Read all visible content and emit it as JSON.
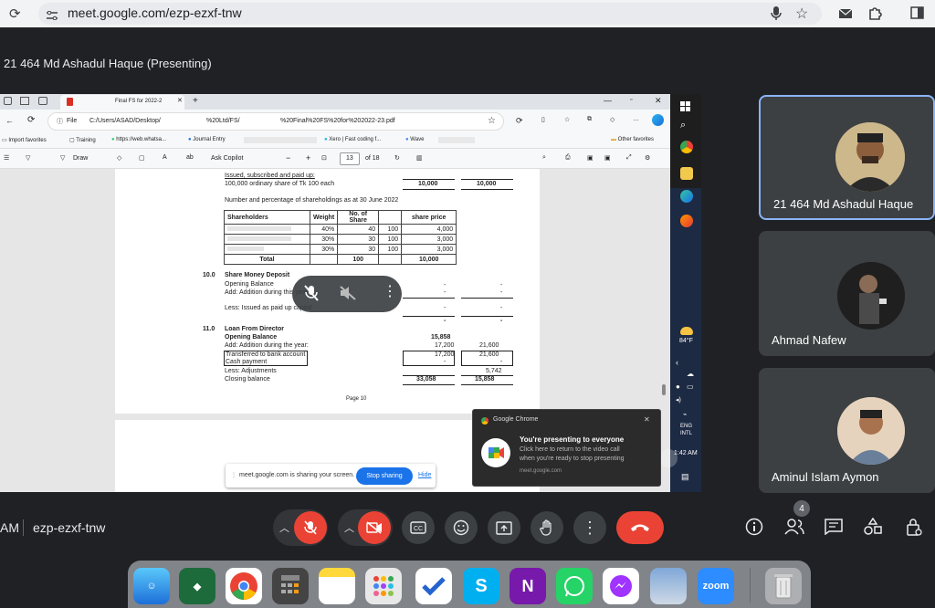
{
  "browser": {
    "url": "meet.google.com/ezp-ezxf-tnw"
  },
  "meet": {
    "presenter_title": "21 464 Md Ashadul Haque (Presenting)",
    "time_fragment": "AM",
    "meeting_code": "ezp-ezxf-tnw",
    "people_count": "4",
    "participants": [
      {
        "name": "21 464 Md Ashadul Haque"
      },
      {
        "name": "Ahmad Nafew"
      },
      {
        "name": "Aminul Islam Aymon"
      }
    ]
  },
  "shared_screen": {
    "edge_tab_title": "Final FS for 2022-2",
    "file_label": "File",
    "file_path_a": "C:/Users/ASAD/Desktop/",
    "file_path_b": "%20Ltd/FS/",
    "file_path_c": "%20Final%20FS%20for%202022-23.pdf",
    "favorites": [
      "Import favorites",
      "Training",
      "https://web.whatsa...",
      "Journal Entry",
      "Xero | Fast coding f...",
      "Wave",
      "Other favorites"
    ],
    "pdf_toolbar": {
      "draw": "Draw",
      "ask_copilot": "Ask Copilot",
      "zoom_minus": "−",
      "zoom_plus": "+",
      "page_current": "13",
      "page_total": "of 18"
    },
    "pdf": {
      "issued_heading": "Issued, subscribed and paid up:",
      "issued_line": "100,000 ordinary share of Tk 100 each",
      "issued_v1": "10,000",
      "issued_v2": "10,000",
      "shareholding_heading": "Number and percentage of shareholdings as at 30 June 2022",
      "table_headers": [
        "Shareholders",
        "Weight",
        "No. of Share",
        "",
        "share price"
      ],
      "table_rows": [
        [
          "",
          "40%",
          "40",
          "100",
          "4,000"
        ],
        [
          "",
          "30%",
          "30",
          "100",
          "3,000"
        ],
        [
          "",
          "30%",
          "30",
          "100",
          "3,000"
        ]
      ],
      "table_total": [
        "Total",
        "",
        "100",
        "",
        "10,000"
      ],
      "s10_num": "10.0",
      "s10_title": "Share Money Deposit",
      "s10_l1": "Opening Balance",
      "s10_l2": "Add:  Addition during this year",
      "s10_l3": "Less: Issued as paid up capital",
      "dash": "-",
      "s11_num": "11.0",
      "s11_title": "Loan From Director",
      "s11_opening": "Opening Balance",
      "s11_opening_v": "15,858",
      "s11_add": "Add: Addition during the year:",
      "s11_add_v1": "17,200",
      "s11_add_v2": "21,600",
      "s11_bank": "Transferred to bank account",
      "s11_bank_v1": "17,200",
      "s11_bank_v2": "21,600",
      "s11_cash": "Cash payment",
      "s11_less": "Less: Adjustments",
      "s11_less_v2": "5,742",
      "s11_closing": "Closing balance",
      "s11_closing_v1": "33,058",
      "s11_closing_v2": "15,858",
      "page_label": "Page 10"
    },
    "taskbar": {
      "weather_temp": "84°F",
      "lang1": "ENG",
      "lang2": "INTL",
      "clock": "1:42 AM"
    },
    "notification": {
      "app": "Google Chrome",
      "title": "You're presenting to everyone",
      "body1": "Click here to return to the video call",
      "body2": "when you're ready to stop presenting",
      "source": "meet.google.com"
    },
    "share_bar": {
      "message": "meet.google.com is sharing your screen.",
      "stop_label": "Stop sharing",
      "hide_label": "Hide"
    }
  },
  "dock": {
    "zoom_label": "zoom",
    "skype_label": "S",
    "onenote_label": "N"
  }
}
